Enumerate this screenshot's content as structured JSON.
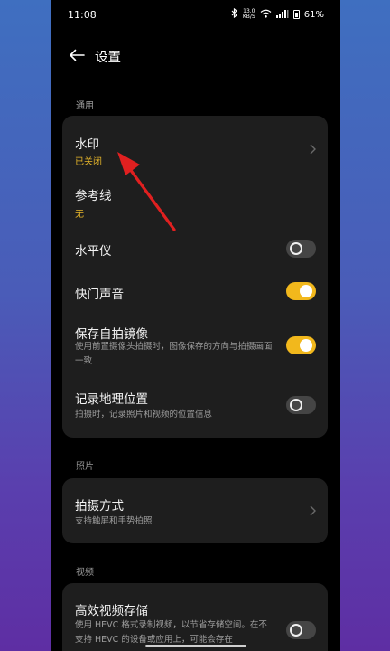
{
  "status_bar": {
    "time": "11:08",
    "bluetooth_icon": "bluetooth-icon",
    "net_speed_value": "13.0",
    "net_speed_unit": "KB/S",
    "wifi_icon": "wifi-icon",
    "signal_icon": "signal-icon",
    "battery": "61%"
  },
  "header": {
    "back_icon": "back-arrow-icon",
    "title": "设置"
  },
  "sections": {
    "general": {
      "label": "通用",
      "watermark": {
        "title": "水印",
        "value": "已关闭"
      },
      "gridlines": {
        "title": "参考线",
        "value": "无"
      },
      "level": {
        "title": "水平仪",
        "enabled": false
      },
      "shutter_sound": {
        "title": "快门声音",
        "enabled": true
      },
      "mirror_selfie": {
        "title": "保存自拍镜像",
        "description": "使用前置摄像头拍摄时，图像保存的方向与拍摄画面一致",
        "enabled": true
      },
      "location": {
        "title": "记录地理位置",
        "description": "拍摄时，记录照片和视频的位置信息",
        "enabled": false
      }
    },
    "photo": {
      "label": "照片",
      "shooting_method": {
        "title": "拍摄方式",
        "description": "支持触屏和手势拍照"
      }
    },
    "video": {
      "label": "视频",
      "hevc": {
        "title": "高效视频存储",
        "description": "使用 HEVC 格式录制视频，以节省存储空间。在不支持 HEVC 的设备或应用上，可能会存在",
        "enabled": false
      }
    }
  },
  "colors": {
    "accent": "#f2b81c",
    "annotation_arrow": "#e02020",
    "card_bg": "#1e1e1e"
  }
}
